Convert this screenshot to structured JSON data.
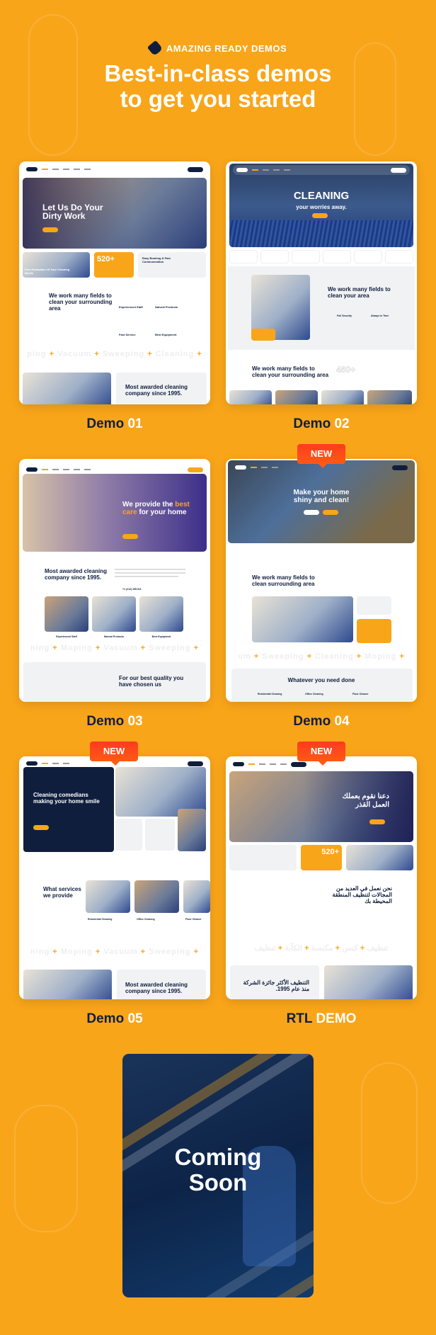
{
  "header": {
    "eyebrow": "AMAZING READY DEMOS",
    "eyebrow_icon": "broom-icon",
    "title_line1": "Best-in-class demos",
    "title_line2": "to get you started"
  },
  "colors": {
    "background": "#F9A51A",
    "navy": "#0f1e3d",
    "badge": "#ff4a1a"
  },
  "badge_new": "NEW",
  "demos": [
    {
      "label": "Demo",
      "num": "01",
      "hero": "Let Us Do Your Dirty Work",
      "stat": "520+",
      "section": "We work many fields to clean your surrounding area",
      "features": [
        "Experienced Staff",
        "Natural Products",
        "Fast Service",
        "Best Equipment"
      ],
      "marquee": "ping + Vacuum + Sweeping + Cleaning +",
      "about": "Most awarded cleaning company since 1995.",
      "card1": "Free Evaluation Of Your Cleaning Needs",
      "card3": "Easy Booking & Fast Communication"
    },
    {
      "label": "Demo",
      "num": "02",
      "hero": "CLEANING",
      "hero_sub": "your worries away.",
      "section": "We work many fields to clean your area",
      "features": [
        "Full Security",
        "Always in Time"
      ],
      "section2": "We work many fields to clean your surrounding area",
      "stat": "460+"
    },
    {
      "label": "Demo",
      "num": "03",
      "hero1": "We provide the",
      "hero2": "best care",
      "hero3": "for your home",
      "section": "Most awarded cleaning company since 1995.",
      "phone": "+1 (212) 255-511",
      "items": [
        "Experienced Staff",
        "Natural Products",
        "Best Equipment"
      ],
      "marquee": "ning + Moping + Vacuum + Sweeping +",
      "section2": "For our best quality you have chosen us"
    },
    {
      "label": "Demo",
      "num": "04",
      "hero": "Make your home shiny and clean!",
      "section": "We work many fields to clean surrounding area",
      "marquee": "um + Sweeping + Cleaning + Moping +",
      "section2": "Whatever you need done",
      "services": [
        "Residential Cleaning",
        "Office Cleaning",
        "Floor Cleaner"
      ],
      "new": true
    },
    {
      "label": "Demo",
      "num": "05",
      "hero": "Cleaning comedians making your home smile",
      "section": "What services we provide",
      "services": [
        "Residential Cleaning",
        "Office Cleaning",
        "Floor Cleaner"
      ],
      "marquee": "ning + Moping + Vacuum + Sweeping +",
      "about": "Most awarded cleaning company since 1995.",
      "new": true
    },
    {
      "label": "RTL",
      "num": "DEMO",
      "hero": "دعنا نقوم بعملك العمل القذر",
      "stat": "520+",
      "section": "نحن نعمل في العديد من المجالات لتنظيف المنطقة المحيطة بك",
      "about": "التنظيف الأكثر جائزة الشركة منذ عام 1995.",
      "marquee": "تنظيف + كنس + مكنسة + الكآبة + تنظيف",
      "new": true
    }
  ],
  "coming_soon": {
    "line1": "Coming",
    "line2": "Soon"
  }
}
